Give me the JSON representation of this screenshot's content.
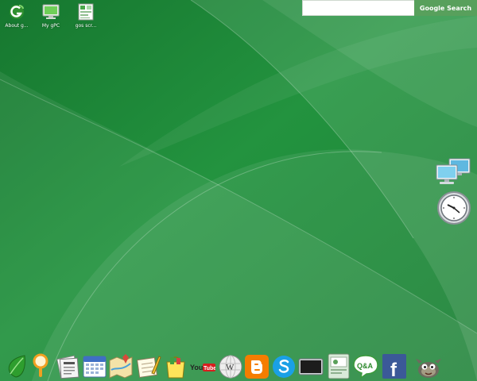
{
  "desktop": {
    "icons": [
      {
        "label": "About g...",
        "icon": "green-g-icon"
      },
      {
        "label": "My gPC",
        "icon": "monitor-icon"
      },
      {
        "label": "gos scr...",
        "icon": "screenshot-icon"
      }
    ]
  },
  "search": {
    "placeholder": "",
    "button_label": "Google Search"
  },
  "widgets": {
    "network": "network-computers-icon",
    "clock": "clock-icon"
  },
  "dock": {
    "items": [
      {
        "name": "leaf-icon"
      },
      {
        "name": "search-magnifier-icon"
      },
      {
        "name": "news-icon"
      },
      {
        "name": "calendar-icon"
      },
      {
        "name": "map-icon"
      },
      {
        "name": "notepad-icon"
      },
      {
        "name": "shopping-bag-icon"
      },
      {
        "name": "youtube-icon",
        "text": "You Tube"
      },
      {
        "name": "wikipedia-icon"
      },
      {
        "name": "blogger-icon"
      },
      {
        "name": "skype-icon"
      },
      {
        "name": "screen-icon"
      },
      {
        "name": "document-icon"
      },
      {
        "name": "qa-chat-icon",
        "text": "Q&A"
      },
      {
        "name": "facebook-icon",
        "text": "f"
      },
      {
        "name": "gimp-icon"
      }
    ]
  },
  "colors": {
    "wallpaper": "#1f8a3a",
    "search_button": "#58a05c"
  }
}
